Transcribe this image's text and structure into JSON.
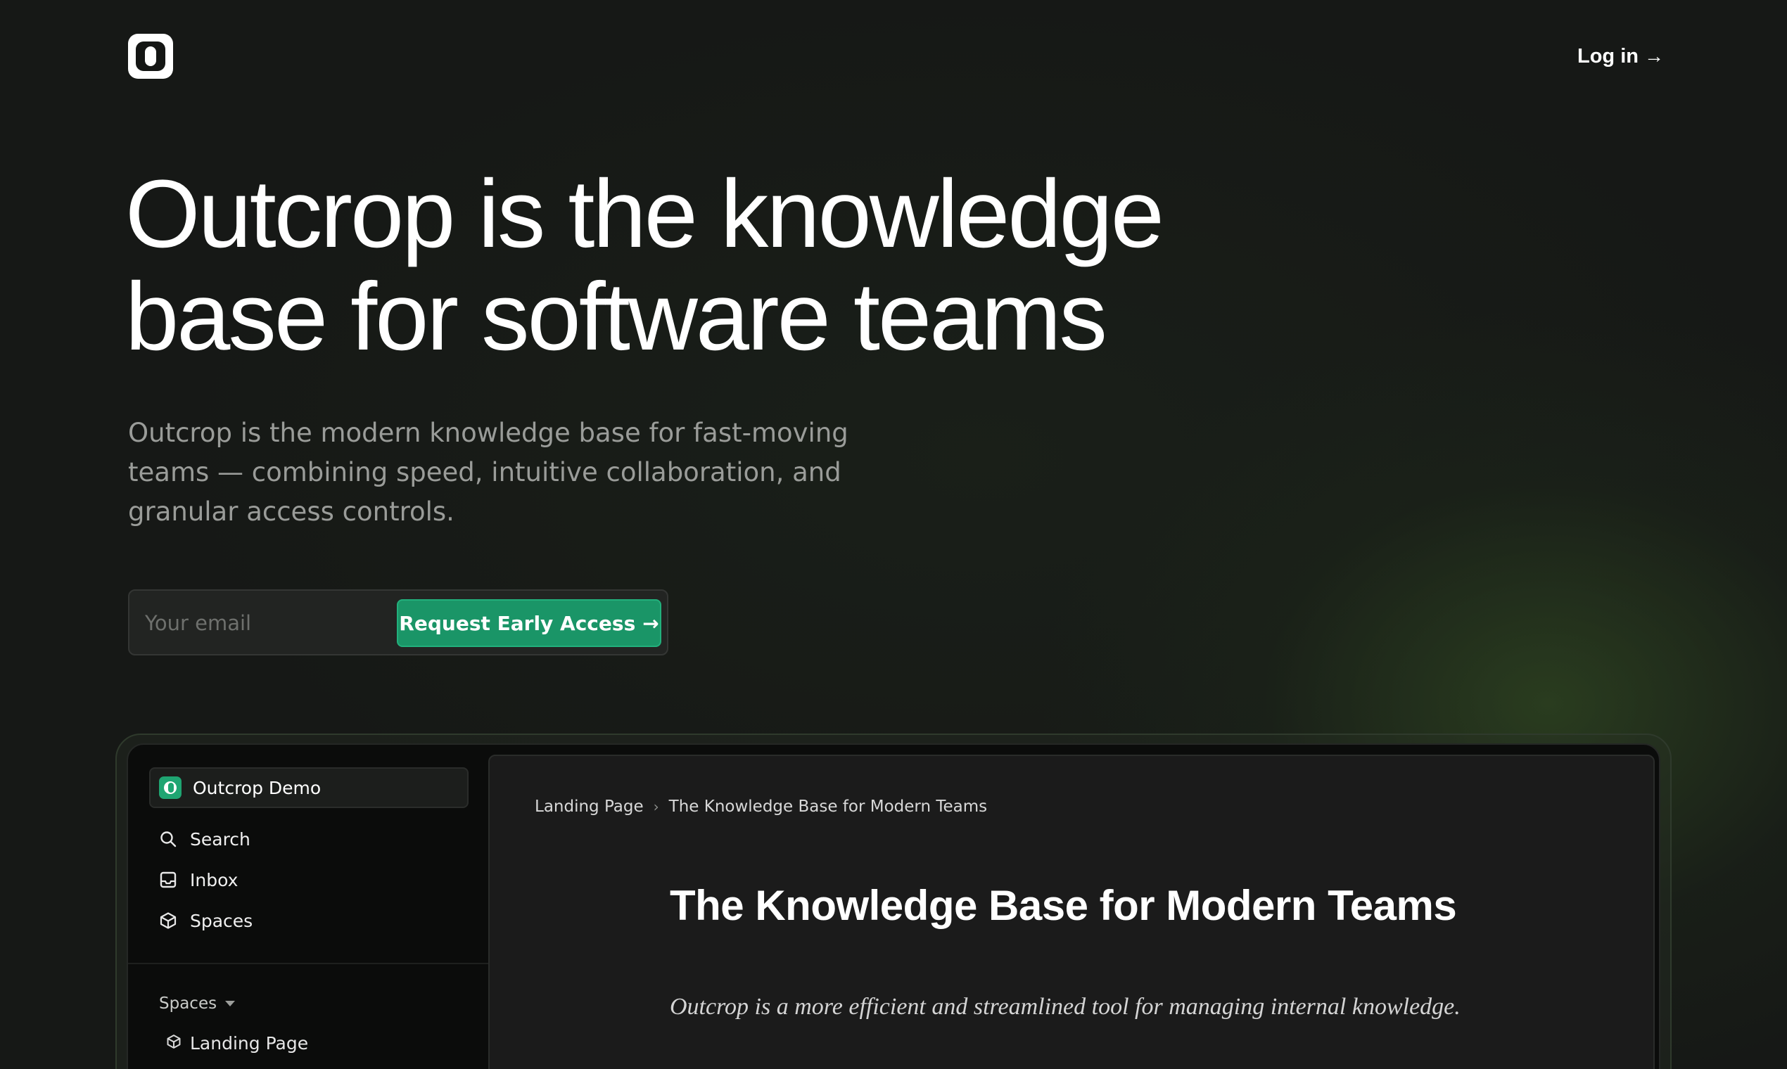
{
  "nav": {
    "logo_name": "outcrop-logo",
    "login_label": "Log in",
    "login_arrow": "→"
  },
  "hero": {
    "headline_line1": "Outcrop is the knowledge",
    "headline_line2": "base for software teams",
    "subtitle": "Outcrop is the modern knowledge base for fast-moving teams — combining speed, intuitive collaboration, and granular access controls."
  },
  "signup": {
    "email_placeholder": "Your email",
    "email_value": "",
    "cta_label": "Request Early Access",
    "cta_arrow": "→"
  },
  "preview": {
    "workspace_name": "Outcrop Demo",
    "sidebar_items": [
      {
        "label": "Search",
        "icon": "search-icon"
      },
      {
        "label": "Inbox",
        "icon": "inbox-icon"
      },
      {
        "label": "Spaces",
        "icon": "cube-icon"
      }
    ],
    "spaces_header": "Spaces",
    "spaces": [
      {
        "label": "Landing Page",
        "icon": "cube-icon"
      }
    ],
    "breadcrumb": [
      "Landing Page",
      "The Knowledge Base for Modern Teams"
    ],
    "breadcrumb_separator": "›",
    "doc_title": "The Knowledge Base for Modern Teams",
    "doc_lead": "Outcrop is a more efficient and streamlined tool for managing internal knowledge."
  },
  "colors": {
    "background": "#161816",
    "accent": "#1a9567",
    "text_primary": "#ffffff",
    "text_muted": "#9a9c99"
  }
}
